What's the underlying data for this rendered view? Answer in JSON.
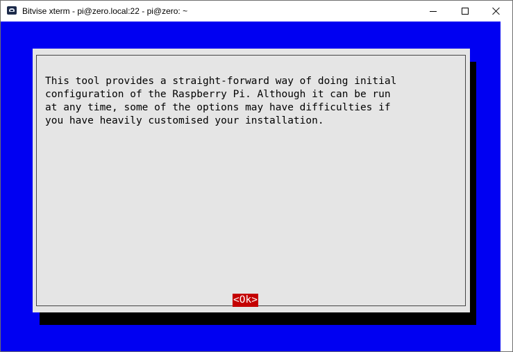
{
  "window": {
    "title": "Bitvise xterm - pi@zero.local:22 - pi@zero: ~",
    "app_icon": "terminal-app-icon",
    "controls": {
      "minimize_icon": "minimize-icon",
      "maximize_icon": "maximize-icon",
      "close_icon": "close-icon"
    }
  },
  "terminal": {
    "background_color": "#0000f2",
    "dialog": {
      "background_color": "#e5e5e5",
      "message_lines": [
        "This tool provides a straight-forward way of doing initial",
        "configuration of the Raspberry Pi. Although it can be run",
        "at any time, some of the options may have difficulties if",
        "you have heavily customised your installation."
      ],
      "ok_label": "<Ok>",
      "ok_color": "#c40000"
    }
  }
}
